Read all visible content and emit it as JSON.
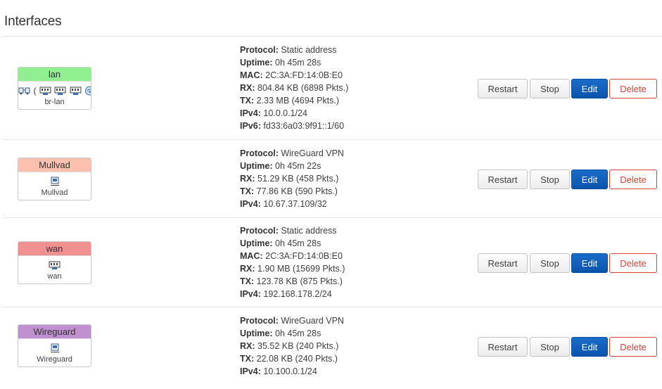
{
  "page": {
    "title": "Interfaces"
  },
  "actions": {
    "restart": "Restart",
    "stop": "Stop",
    "edit": "Edit",
    "delete": "Delete"
  },
  "interfaces": [
    {
      "name": "lan",
      "device": "br-lan",
      "color": "#90f090",
      "details": [
        {
          "label": "Protocol:",
          "value": "Static address"
        },
        {
          "label": "Uptime:",
          "value": "0h 45m 28s"
        },
        {
          "label": "MAC:",
          "value": "2C:3A:FD:14:0B:E0"
        },
        {
          "label": "RX:",
          "value": "804.84 KB (6898 Pkts.)"
        },
        {
          "label": "TX:",
          "value": "2.33 MB (4694 Pkts.)"
        },
        {
          "label": "IPv4:",
          "value": "10.0.0.1/24"
        },
        {
          "label": "IPv6:",
          "value": "fd33:6a03:9f91::1/60"
        }
      ]
    },
    {
      "name": "Mullvad",
      "device": "Mullvad",
      "color": "#ffc0b0",
      "details": [
        {
          "label": "Protocol:",
          "value": "WireGuard VPN"
        },
        {
          "label": "Uptime:",
          "value": "0h 45m 22s"
        },
        {
          "label": "RX:",
          "value": "51.29 KB (458 Pkts.)"
        },
        {
          "label": "TX:",
          "value": "77.86 KB (590 Pkts.)"
        },
        {
          "label": "IPv4:",
          "value": "10.67.37.109/32"
        }
      ]
    },
    {
      "name": "wan",
      "device": "wan",
      "color": "#f09090",
      "details": [
        {
          "label": "Protocol:",
          "value": "Static address"
        },
        {
          "label": "Uptime:",
          "value": "0h 45m 28s"
        },
        {
          "label": "MAC:",
          "value": "2C:3A:FD:14:0B:E0"
        },
        {
          "label": "RX:",
          "value": "1.90 MB (15699 Pkts.)"
        },
        {
          "label": "TX:",
          "value": "123.78 KB (875 Pkts.)"
        },
        {
          "label": "IPv4:",
          "value": "192.168.178.2/24"
        }
      ]
    },
    {
      "name": "Wireguard",
      "device": "Wireguard",
      "color": "#c090d0",
      "details": [
        {
          "label": "Protocol:",
          "value": "WireGuard VPN"
        },
        {
          "label": "Uptime:",
          "value": "0h 45m 28s"
        },
        {
          "label": "RX:",
          "value": "35.52 KB (240 Pkts.)"
        },
        {
          "label": "TX:",
          "value": "22.08 KB (240 Pkts.)"
        },
        {
          "label": "IPv4:",
          "value": "10.100.0.1/24"
        }
      ]
    }
  ]
}
